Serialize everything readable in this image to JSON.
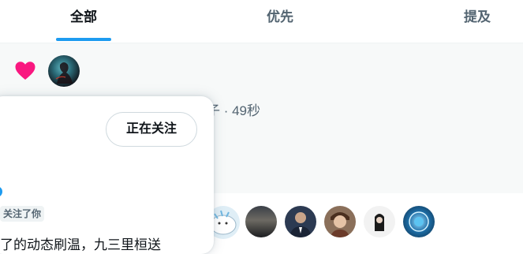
{
  "tabs": {
    "all": "全部",
    "priority": "优先",
    "mentions": "提及"
  },
  "notification": {
    "time_text": "子 · 49秒"
  },
  "profile_popup": {
    "follow_button_label": "正在关注",
    "follows_you_badge": "关注了你",
    "bio_fragment": "了的动态刷温，九三里桓送"
  },
  "colors": {
    "accent": "#1d9bf0",
    "like": "#f91880",
    "muted_text": "#536471"
  },
  "icons": {
    "like": "heart-icon",
    "verified": "verified-badge-icon"
  }
}
